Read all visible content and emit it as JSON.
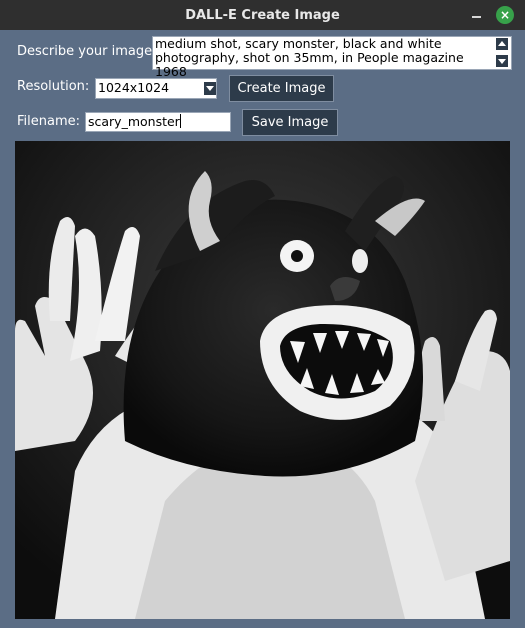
{
  "window": {
    "title": "DALL-E Create Image",
    "close_glyph": "×"
  },
  "form": {
    "describe_label": "Describe your image:",
    "prompt_value": "medium shot, scary monster, black and white\nphotography, shot on 35mm, in People magazine 1968",
    "resolution_label": "Resolution:",
    "resolution_value": "1024x1024",
    "create_button": "Create Image",
    "filename_label": "Filename:",
    "filename_value": "scary_monster",
    "save_button": "Save Image"
  },
  "image": {
    "description": "black and white generated photo of a shaggy monster with raised clawed hands and open fanged mouth",
    "icon": "generated-image"
  },
  "colors": {
    "window_bg": "#5b6d85",
    "titlebar": "#2f2f2f",
    "button": "#2d3b4a",
    "close_button": "#37a14a"
  }
}
